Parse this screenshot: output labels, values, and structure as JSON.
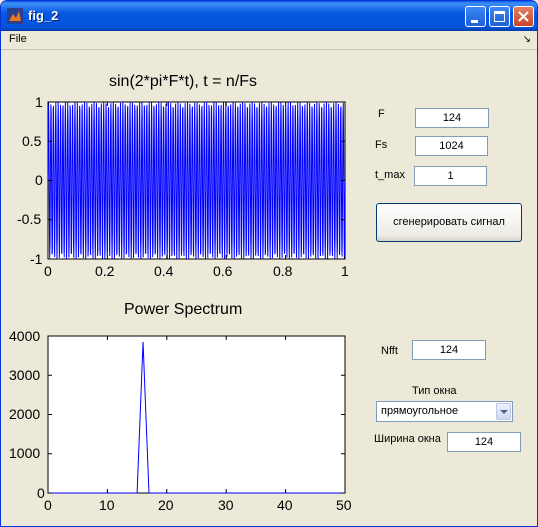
{
  "window": {
    "title": "fig_2"
  },
  "menu": {
    "file": "File",
    "dock_glyph": "↘"
  },
  "axes1": {
    "title": "sin(2*pi*F*t), t = n/Fs",
    "xticks": [
      "0",
      "0.2",
      "0.4",
      "0.6",
      "0.8",
      "1"
    ],
    "yticks": [
      "1",
      "0.5",
      "0",
      "-0.5",
      "-1"
    ]
  },
  "axes2": {
    "title": "Power Spectrum",
    "xticks": [
      "0",
      "10",
      "20",
      "30",
      "40",
      "50"
    ],
    "yticks": [
      "4000",
      "3000",
      "2000",
      "1000",
      "0"
    ]
  },
  "controls": {
    "F_label": "F",
    "F_value": "124",
    "Fs_label": "Fs",
    "Fs_value": "1024",
    "tmax_label": "t_max",
    "tmax_value": "1",
    "generate_label": "сгенерировать сигнал",
    "nfft_label": "Nfft",
    "nfft_value": "124",
    "window_type_label": "Тип окна",
    "window_type_value": "прямоугольное",
    "window_width_label": "Ширина окна",
    "window_width_value": "124"
  },
  "colors": {
    "line": "#0000ff",
    "titlebar": "#0a5ee8",
    "face": "#ece9d8"
  },
  "chart_data": [
    {
      "type": "line",
      "title": "sin(2*pi*F*t), t = n/Fs",
      "xlabel": "",
      "ylabel": "",
      "xlim": [
        0,
        1
      ],
      "ylim": [
        -1,
        1
      ],
      "series": [
        {
          "function": "sin(2*pi*124*t)",
          "sample_rate": 1024,
          "x_start": 0,
          "x_end": 1
        }
      ]
    },
    {
      "type": "line",
      "title": "Power Spectrum",
      "xlabel": "",
      "ylabel": "",
      "xlim": [
        0,
        50
      ],
      "ylim": [
        0,
        4000
      ],
      "x": [
        0,
        14,
        15,
        16,
        17,
        18,
        50
      ],
      "series": [
        {
          "values": [
            0,
            0,
            0,
            3850,
            0,
            0,
            0
          ]
        }
      ]
    }
  ]
}
